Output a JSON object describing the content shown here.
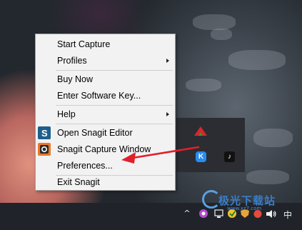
{
  "menu": {
    "items": [
      {
        "label": "Start Capture",
        "submenu": false
      },
      {
        "label": "Profiles",
        "submenu": true
      },
      {
        "label": "Buy Now",
        "submenu": false
      },
      {
        "label": "Enter Software Key...",
        "submenu": false
      },
      {
        "label": "Help",
        "submenu": true
      },
      {
        "label": "Open Snagit Editor",
        "submenu": false,
        "icon": "snagit-editor-icon"
      },
      {
        "label": "Snagit Capture Window",
        "submenu": false,
        "icon": "snagit-capture-icon"
      },
      {
        "label": "Preferences...",
        "submenu": false
      },
      {
        "label": "Exit Snagit",
        "submenu": false
      }
    ]
  },
  "tray": {
    "icons": [
      "tray-red-app-icon",
      "tray-k-app-icon",
      "tray-tiktok-icon"
    ]
  },
  "taskbar": {
    "show_hidden_icons": "^",
    "ime_label": "中",
    "icons": [
      "chevron-up-icon",
      "network-icon",
      "security-icon",
      "volume-icon"
    ]
  },
  "annotation": {
    "arrow_color": "#e0202a"
  },
  "watermark": {
    "text": "极光下载站",
    "url": "www.xz7.com"
  }
}
